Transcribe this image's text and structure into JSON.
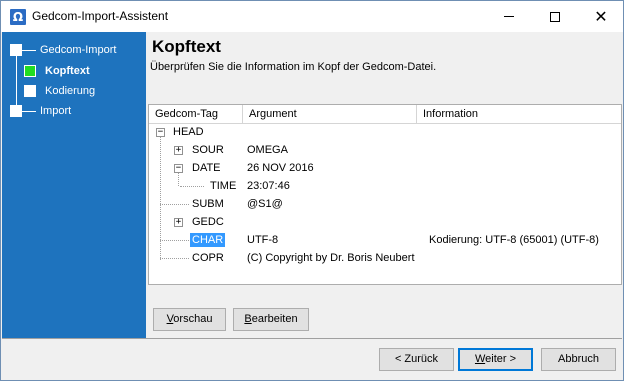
{
  "window": {
    "icon_glyph": "Ω",
    "title": "Gedcom-Import-Assistent"
  },
  "sidebar": {
    "steps": [
      {
        "label": "Gedcom-Import",
        "active": false
      },
      {
        "label": "Kopftext",
        "active": true
      },
      {
        "label": "Kodierung",
        "active": false
      },
      {
        "label": "Import",
        "active": false
      }
    ]
  },
  "content": {
    "title": "Kopftext",
    "subtitle": "Überprüfen Sie die Information im Kopf der Gedcom-Datei."
  },
  "grid": {
    "columns": [
      "Gedcom-Tag",
      "Argument",
      "Information"
    ],
    "rows": [
      {
        "tag": "HEAD",
        "argument": "",
        "information": ""
      },
      {
        "tag": "SOUR",
        "argument": "OMEGA",
        "information": ""
      },
      {
        "tag": "DATE",
        "argument": "26 NOV 2016",
        "information": ""
      },
      {
        "tag": "TIME",
        "argument": "23:07:46",
        "information": ""
      },
      {
        "tag": "SUBM",
        "argument": "@S1@",
        "information": ""
      },
      {
        "tag": "GEDC",
        "argument": "",
        "information": ""
      },
      {
        "tag": "CHAR",
        "argument": "UTF-8",
        "information": "Kodierung: UTF-8 (65001) (UTF-8)"
      },
      {
        "tag": "COPR",
        "argument": "(C) Copyright by Dr. Boris Neubert",
        "information": ""
      }
    ]
  },
  "actions": {
    "preview_first": "V",
    "preview_rest": "orschau",
    "edit_first": "B",
    "edit_rest": "earbeiten"
  },
  "footer": {
    "back_label": "< Zurück",
    "next_first": "W",
    "next_rest": "eiter >",
    "cancel_label": "Abbruch"
  },
  "colors": {
    "sidebar": "#1e73be",
    "active_step": "#22dd22",
    "selection": "#3399ff"
  }
}
